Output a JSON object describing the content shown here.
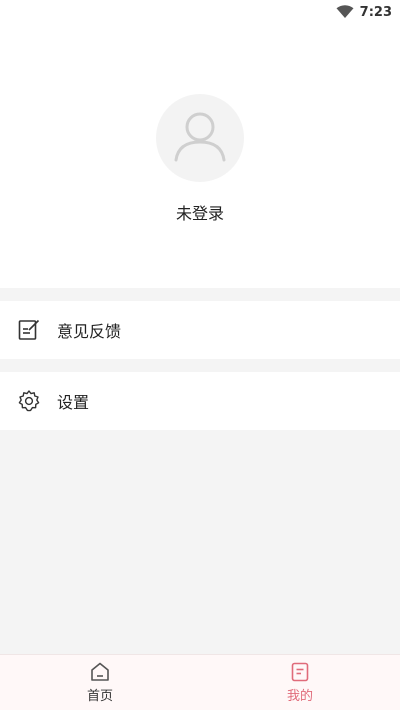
{
  "status_bar": {
    "time": "7:23"
  },
  "profile": {
    "login_status": "未登录"
  },
  "menu": [
    {
      "label": "意见反馈",
      "icon": "feedback-icon"
    },
    {
      "label": "设置",
      "icon": "gear-icon"
    }
  ],
  "tabbar": {
    "tabs": [
      {
        "label": "首页",
        "icon": "home-icon",
        "active": false
      },
      {
        "label": "我的",
        "icon": "profile-doc-icon",
        "active": true
      }
    ]
  },
  "colors": {
    "accent": "#e06b7a",
    "background": "#f4f4f4"
  }
}
